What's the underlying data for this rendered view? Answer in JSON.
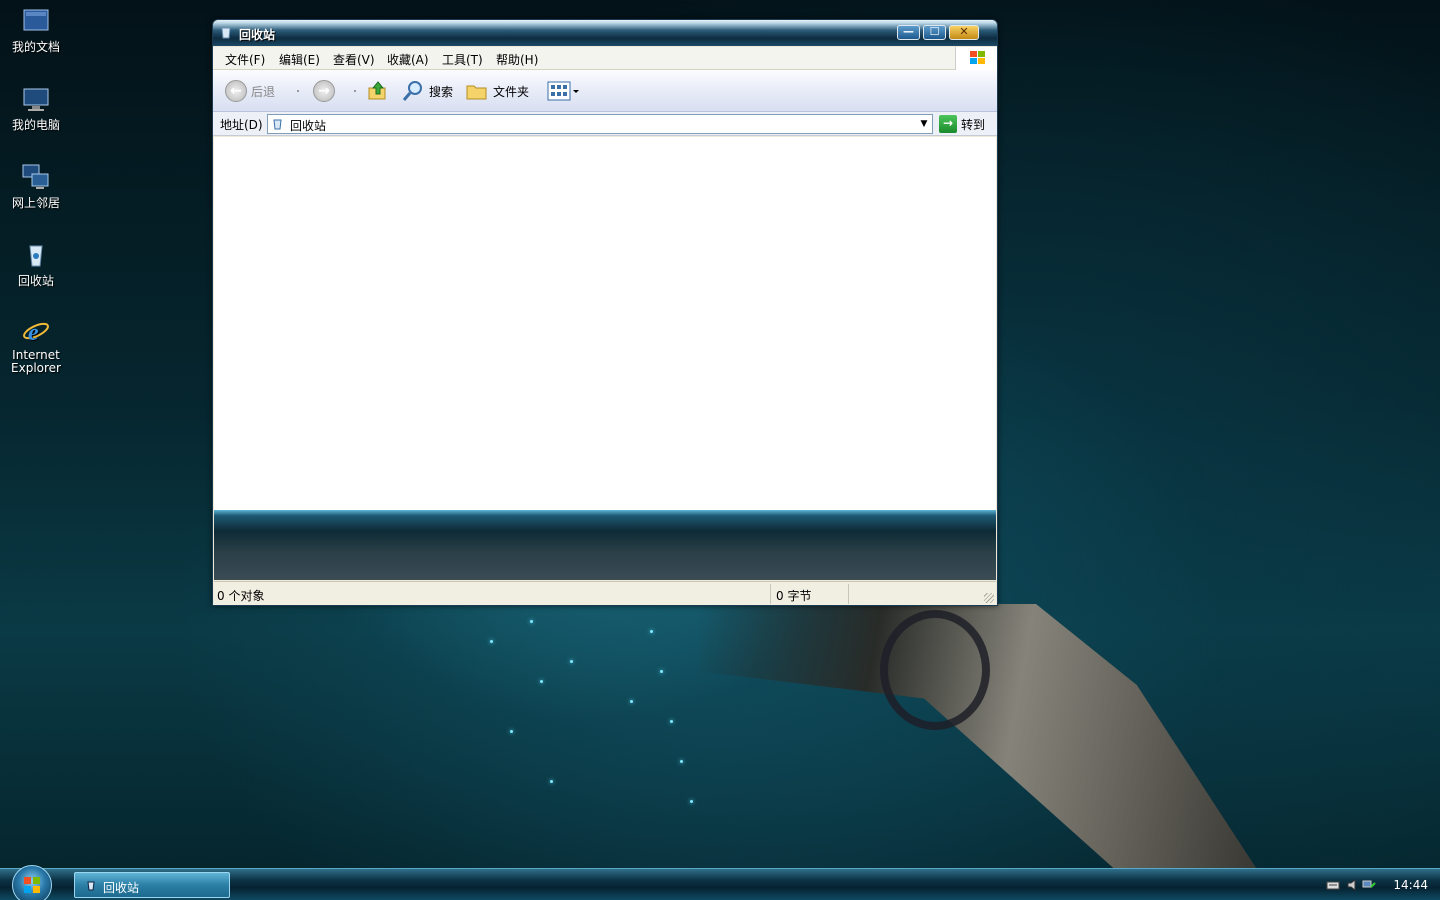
{
  "desktop": {
    "icons": [
      {
        "label": "我的文档"
      },
      {
        "label": "我的电脑"
      },
      {
        "label": "网上邻居"
      },
      {
        "label": "回收站"
      },
      {
        "label_line1": "Internet",
        "label_line2": "Explorer"
      }
    ]
  },
  "window": {
    "title": "回收站",
    "controls": {
      "minimize": "—",
      "maximize": "☐",
      "close": "✕"
    },
    "menu": [
      "文件(F)",
      "编辑(E)",
      "查看(V)",
      "收藏(A)",
      "工具(T)",
      "帮助(H)"
    ],
    "toolbar": {
      "back_label": "后退",
      "search_label": "搜索",
      "folders_label": "文件夹"
    },
    "address": {
      "label": "地址(D)",
      "value": "回收站",
      "go_label": "转到"
    },
    "status": {
      "objects": "0 个对象",
      "size": "0 字节"
    }
  },
  "taskbar": {
    "task_label": "回收站",
    "clock": "14:44"
  },
  "colors": {
    "accent": "#2b5b78",
    "taskbar": "#0c3447"
  }
}
